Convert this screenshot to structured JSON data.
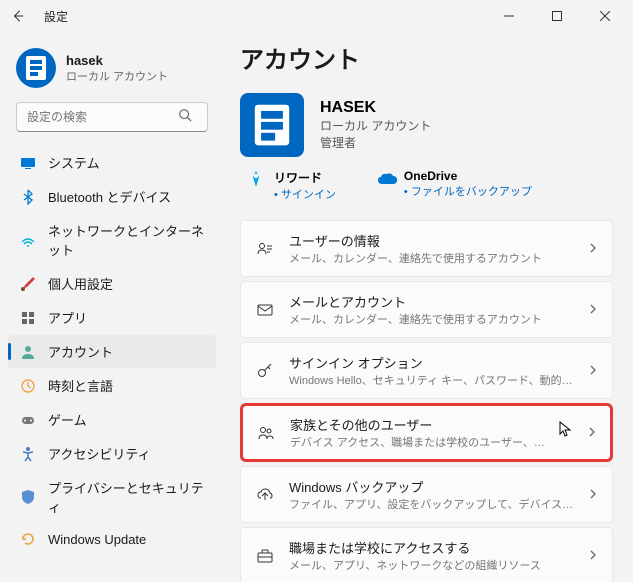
{
  "titlebar": {
    "title": "設定"
  },
  "user": {
    "name": "hasek",
    "type": "ローカル アカウント"
  },
  "search": {
    "placeholder": "設定の検索"
  },
  "nav": {
    "items": [
      {
        "label": "システム"
      },
      {
        "label": "Bluetooth とデバイス"
      },
      {
        "label": "ネットワークとインターネット"
      },
      {
        "label": "個人用設定"
      },
      {
        "label": "アプリ"
      },
      {
        "label": "アカウント"
      },
      {
        "label": "時刻と言語"
      },
      {
        "label": "ゲーム"
      },
      {
        "label": "アクセシビリティ"
      },
      {
        "label": "プライバシーとセキュリティ"
      },
      {
        "label": "Windows Update"
      }
    ]
  },
  "page": {
    "title": "アカウント",
    "account": {
      "name": "HASEK",
      "type": "ローカル アカウント",
      "role": "管理者"
    },
    "promos": [
      {
        "title": "リワード",
        "link": "サインイン"
      },
      {
        "title": "OneDrive",
        "link": "ファイルをバックアップ"
      }
    ],
    "cards": [
      {
        "title": "ユーザーの情報",
        "sub": "メール、カレンダー、連絡先で使用するアカウント"
      },
      {
        "title": "メールとアカウント",
        "sub": "メール、カレンダー、連絡先で使用するアカウント"
      },
      {
        "title": "サインイン オプション",
        "sub": "Windows Hello、セキュリティ キー、パスワード、動的ロック"
      },
      {
        "title": "家族とその他のユーザー",
        "sub": "デバイス アクセス、職場または学校のユーザー、キオスクに割り当てられたアクセス"
      },
      {
        "title": "Windows バックアップ",
        "sub": "ファイル、アプリ、設定をバックアップして、デバイス間で復元"
      },
      {
        "title": "職場または学校にアクセスする",
        "sub": "メール、アプリ、ネットワークなどの組織リソース"
      }
    ]
  }
}
